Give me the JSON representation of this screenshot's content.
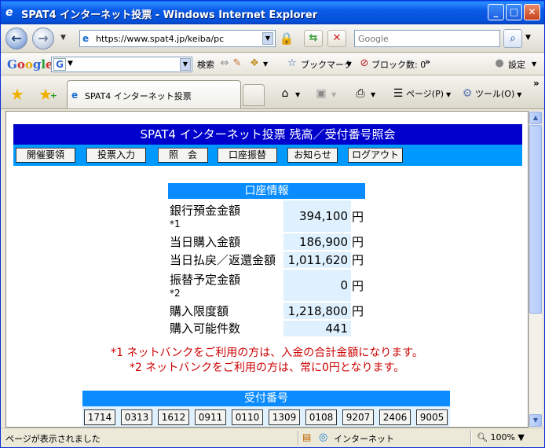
{
  "window": {
    "title": "SPAT4 インターネット投票 - Windows Internet Explorer",
    "buttons": {
      "minimize": "_",
      "maximize": "□",
      "close": "✕"
    }
  },
  "addressbar": {
    "url": "https://www.spat4.jp/keiba/pc",
    "search_placeholder": "Google"
  },
  "google_toolbar": {
    "logo": "Google",
    "search_label": "検索",
    "bookmarks_label": "ブックマーク",
    "popup_blocked_label": "ブロック数: 0",
    "more": "»",
    "settings_label": "設定"
  },
  "tabs": [
    {
      "label": "SPAT4 インターネット投票"
    }
  ],
  "commandbar": {
    "page_label": "ページ(P)",
    "tools_label": "ツール(O)",
    "more": "»"
  },
  "page": {
    "banner": "SPAT4 インターネット投票 残高／受付番号照会",
    "menu": [
      "開催要領",
      "投票入力",
      "照　会",
      "口座振替",
      "お知らせ",
      "ログアウト"
    ],
    "account": {
      "header": "口座情報",
      "unit": "円",
      "rows": [
        {
          "label": "銀行預金金額",
          "sub": "*1",
          "value": "394,100",
          "unit": "円"
        },
        {
          "label": "当日購入金額",
          "sub": "",
          "value": "186,900",
          "unit": "円"
        },
        {
          "label": "当日払戻／返還金額",
          "sub": "",
          "value": "1,011,620",
          "unit": "円"
        },
        {
          "label": "振替予定金額",
          "sub": "*2",
          "value": "0",
          "unit": "円"
        },
        {
          "label": "購入限度額",
          "sub": "",
          "value": "1,218,800",
          "unit": "円"
        },
        {
          "label": "購入可能件数",
          "sub": "",
          "value": "441",
          "unit": ""
        }
      ]
    },
    "notes": [
      "*1 ネットバンクをご利用の方は、入金の合計金額になります。",
      "*2 ネットバンクをご利用の方は、常に0円となります。"
    ],
    "receipt": {
      "header": "受付番号",
      "numbers": [
        "1714",
        "0313",
        "1612",
        "0911",
        "0110",
        "1309",
        "0108",
        "9207",
        "2406",
        "9005"
      ]
    }
  },
  "statusbar": {
    "status": "ページが表示されました",
    "zone": "インターネット",
    "zoom": "100%"
  }
}
